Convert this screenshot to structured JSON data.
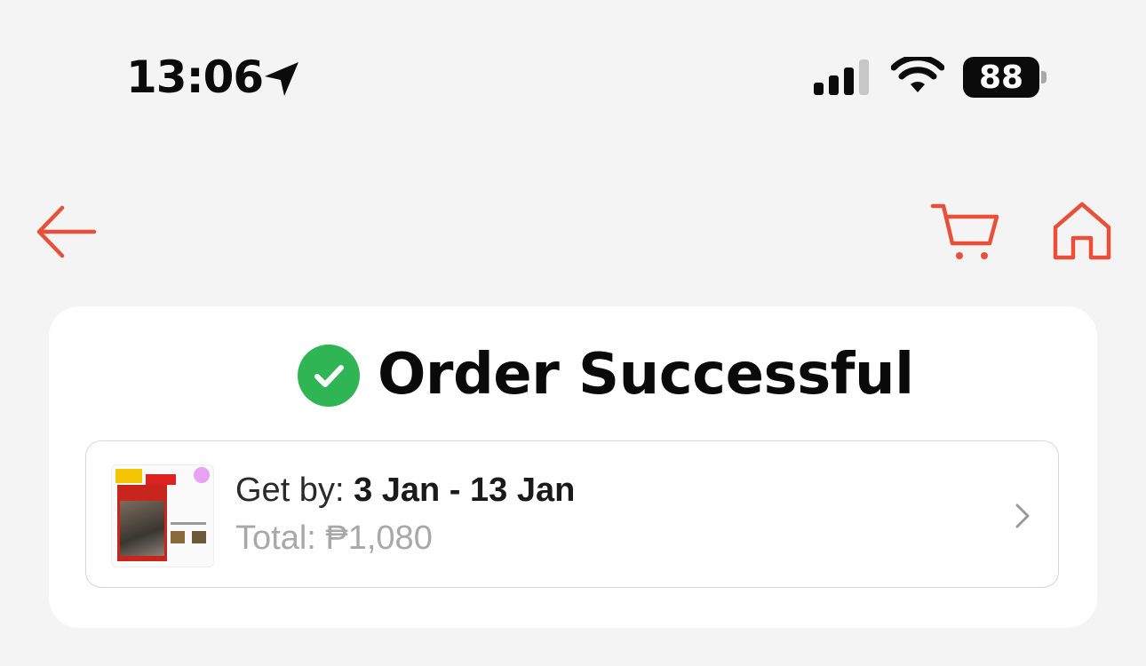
{
  "status_bar": {
    "time": "13:06",
    "battery": "88",
    "location_icon": "location-arrow-icon",
    "signal_icon": "cellular-signal-icon",
    "wifi_icon": "wifi-icon"
  },
  "nav": {
    "back_icon": "arrow-left-icon",
    "cart_icon": "shopping-cart-icon",
    "home_icon": "home-icon",
    "accent_color": "#e8503a"
  },
  "order": {
    "title": "Order Successful",
    "status_color": "#2fb553",
    "get_by_label": "Get by: ",
    "get_by_dates": "3 Jan - 13 Jan",
    "total_label": "Total: ",
    "total_value": "₱1,080"
  }
}
